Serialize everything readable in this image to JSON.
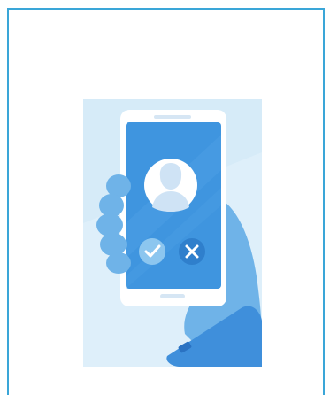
{
  "card": {
    "illustration": {
      "description_icon": "incoming-call-accept-decline-illustration",
      "colors": {
        "background": "#d6ebf8",
        "phone_body": "#ffffff",
        "phone_screen": "#3f95df",
        "avatar": "#ffffff",
        "accept_button": "#8cc6ef",
        "decline_button": "#2f7fcc",
        "hand": "#6fb3e8",
        "sleeve": "#3f8fdb"
      }
    }
  }
}
